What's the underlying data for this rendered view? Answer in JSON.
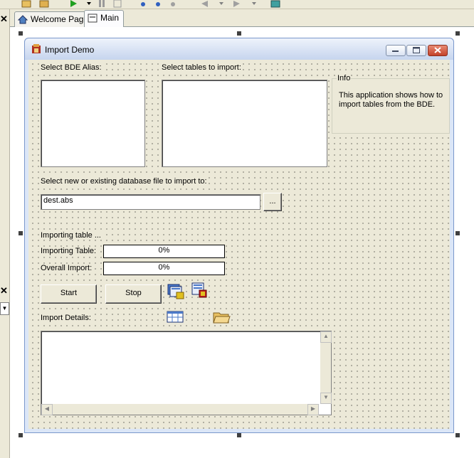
{
  "tabs": [
    {
      "label": "Welcome Page"
    },
    {
      "label": "Main"
    }
  ],
  "form": {
    "title": "Import Demo",
    "select_bde_alias_label": "Select BDE Alias:",
    "select_tables_label": "Select tables to import:",
    "info": {
      "caption": "Info",
      "text": "This application shows how to import tables from the BDE."
    },
    "dest_label": "Select new or existing database file to import to:",
    "dest_value": "dest.abs",
    "browse_label": "...",
    "status_text": "Importing table ...",
    "importing_table_label": "Importing Table:",
    "importing_table_progress": "0%",
    "overall_import_label": "Overall Import:",
    "overall_import_progress": "0%",
    "start_label": "Start",
    "stop_label": "Stop",
    "import_details_label": "Import Details:"
  },
  "colors": {
    "window_border": "#7a98cc",
    "form_face": "#ece9d8",
    "close_button": "#c4422a"
  }
}
